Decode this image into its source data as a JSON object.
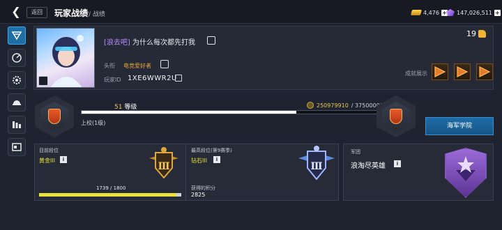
{
  "topbar": {
    "back_label": "返回",
    "title": "玩家战绩",
    "subtitle": "// 战绩",
    "gold": "4,476",
    "gems": "147,026,511"
  },
  "sidebar": {
    "items": [
      {
        "icon": "overview-icon",
        "active": true
      },
      {
        "icon": "radar-icon",
        "active": false
      },
      {
        "icon": "gear-icon",
        "active": false
      },
      {
        "icon": "helmet-icon",
        "active": false
      },
      {
        "icon": "ranking-bars-icon",
        "active": false
      },
      {
        "icon": "id-card-icon",
        "active": false
      }
    ]
  },
  "profile": {
    "signature_tag": "[浪去吧]",
    "signature_text": "为什么每次都先打我",
    "title_label": "头衔",
    "title_value": "电竞爱好者",
    "player_id_label": "玩家ID",
    "player_id": "1XE6WWR2U",
    "likes": "19",
    "achievement_label": "成就展示"
  },
  "rank": {
    "level_num": "51",
    "level_word": "等级",
    "exp_current": "250979910",
    "exp_total": "/ 375000000",
    "exp_fraction": 0.669,
    "rank_name": "上校(1级)"
  },
  "navy_button": "海军学院",
  "stats": {
    "current_label": "目前段位",
    "current_value": "黄金III",
    "progress_text": "1739 / 1800",
    "progress_fraction": 0.966,
    "best_label": "最高段位(第9赛季)",
    "best_value": "钻石III",
    "points_label": "获得的积分",
    "points_value": "2825"
  },
  "legion": {
    "label": "军团",
    "name": "浪淘尽英雄"
  },
  "colors": {
    "accent_blue": "#1e6ca9",
    "gold_text": "#e8e23a",
    "title_orange": "#e6a63b",
    "tag_purple": "#b58cff"
  }
}
